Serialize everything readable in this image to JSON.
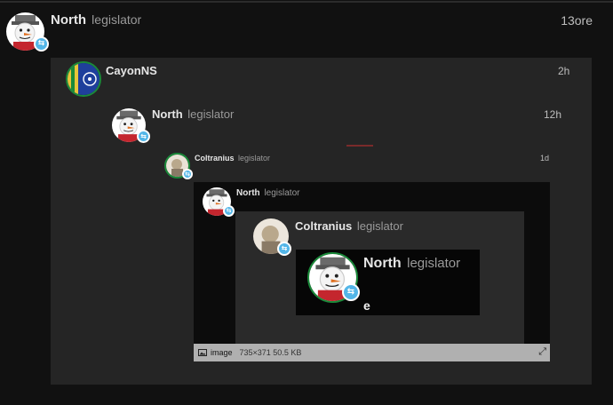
{
  "posts": [
    {
      "user": "North",
      "title": "legislator",
      "time": "13ore"
    },
    {
      "user": "CayonNS",
      "title": "",
      "time": "2h"
    },
    {
      "user": "North",
      "title": "legislator",
      "time": "12h"
    },
    {
      "user": "Coltranius",
      "title": "legislator",
      "time": "1d"
    }
  ],
  "embed": {
    "header": {
      "user": "North",
      "title": "legislator"
    },
    "quote": {
      "user": "Coltranius",
      "title": "legislator"
    },
    "inner_quote": {
      "user": "North",
      "title": "legislator",
      "body": "e"
    }
  },
  "image_meta": {
    "label": "image",
    "dims": "735×371 50.5 KB"
  },
  "icons": {
    "badge": "switch-arrows-icon",
    "image": "image-icon",
    "expand": "expand-icon"
  },
  "colors": {
    "badge": "#53b6e8",
    "flag_blue": "#1f3f9c",
    "flag_green": "#1a8a3a"
  }
}
